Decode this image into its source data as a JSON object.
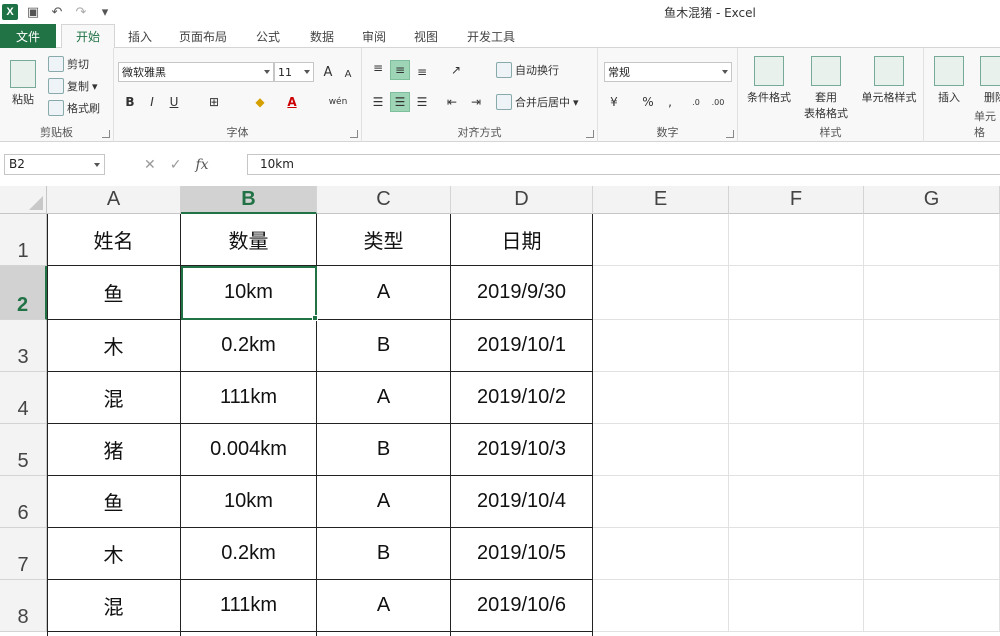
{
  "window": {
    "title": "鱼木混猪 - Excel",
    "app_icon": "X"
  },
  "quick_access": [
    "save-icon",
    "undo-icon",
    "redo-icon",
    "customize-icon"
  ],
  "tabs": {
    "file": "文件",
    "home": "开始",
    "insert": "插入",
    "layout": "页面布局",
    "formulas": "公式",
    "data": "数据",
    "review": "审阅",
    "view": "视图",
    "developer": "开发工具"
  },
  "ribbon": {
    "clipboard": {
      "paste": "粘贴",
      "cut": "剪切",
      "copy": "复制",
      "format_painter": "格式刷",
      "label": "剪贴板"
    },
    "font": {
      "name": "微软雅黑",
      "size": "11",
      "grow": "A",
      "shrink": "A",
      "bold": "B",
      "italic": "I",
      "underline": "U",
      "phonetic": "wén",
      "label": "字体"
    },
    "alignment": {
      "wrap_text": "自动换行",
      "merge_center": "合并后居中",
      "label": "对齐方式"
    },
    "number": {
      "format": "常规",
      "percent": "%",
      "comma": ",",
      "label": "数字"
    },
    "styles": {
      "conditional": "条件格式",
      "table_format_1": "套用",
      "table_format_2": "表格格式",
      "cell_styles": "单元格样式",
      "label": "样式"
    },
    "cells": {
      "insert": "插入",
      "delete": "删除",
      "label": "单元格"
    }
  },
  "formula_bar": {
    "name_box": "B2",
    "content": "10km",
    "fx": "fx"
  },
  "columns": [
    "A",
    "B",
    "C",
    "D",
    "E",
    "F",
    "G"
  ],
  "rows": [
    "1",
    "2",
    "3",
    "4",
    "5",
    "6",
    "7",
    "8"
  ],
  "sheet": {
    "headers": [
      "姓名",
      "数量",
      "类型",
      "日期"
    ],
    "data": [
      [
        "鱼",
        "10km",
        "A",
        "2019/9/30"
      ],
      [
        "木",
        "0.2km",
        "B",
        "2019/10/1"
      ],
      [
        "混",
        "111km",
        "A",
        "2019/10/2"
      ],
      [
        "猪",
        "0.004km",
        "B",
        "2019/10/3"
      ],
      [
        "鱼",
        "10km",
        "A",
        "2019/10/4"
      ],
      [
        "木",
        "0.2km",
        "B",
        "2019/10/5"
      ],
      [
        "混",
        "111km",
        "A",
        "2019/10/6"
      ]
    ]
  },
  "colors": {
    "accent": "#217346",
    "selection_header": "#d2d2d2"
  }
}
